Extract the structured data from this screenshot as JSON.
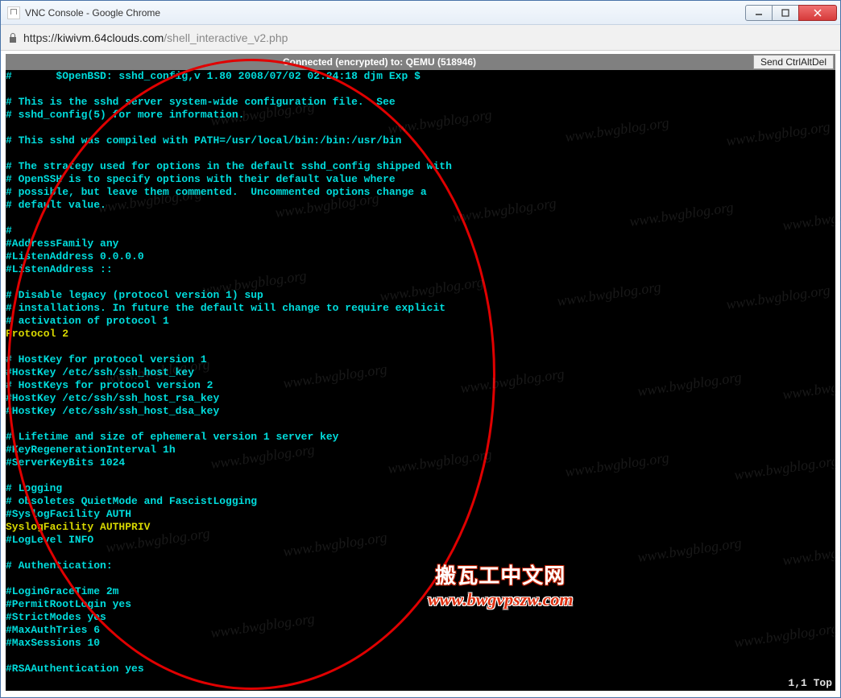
{
  "window": {
    "title": "VNC Console - Google Chrome"
  },
  "address": {
    "scheme": "https://",
    "host": "kiwivm.64clouds.com",
    "path": "/shell_interactive_v2.php"
  },
  "vnc": {
    "status": "Connected (encrypted) to: QEMU (518946)",
    "cad_button": "Send CtrlAltDel"
  },
  "terminal_lines": [
    {
      "t": "#       $OpenBSD: sshd_config,v 1.80 2008/07/02 02:24:18 djm Exp $",
      "c": "cyan"
    },
    {
      "t": "",
      "c": "cyan"
    },
    {
      "t": "# This is the sshd server system-wide configuration file.  See",
      "c": "cyan"
    },
    {
      "t": "# sshd_config(5) for more information.",
      "c": "cyan"
    },
    {
      "t": "",
      "c": "cyan"
    },
    {
      "t": "# This sshd was compiled with PATH=/usr/local/bin:/bin:/usr/bin",
      "c": "cyan"
    },
    {
      "t": "",
      "c": "cyan"
    },
    {
      "t": "# The strategy used for options in the default sshd_config shipped with",
      "c": "cyan"
    },
    {
      "t": "# OpenSSH is to specify options with their default value where",
      "c": "cyan"
    },
    {
      "t": "# possible, but leave them commented.  Uncommented options change a",
      "c": "cyan"
    },
    {
      "t": "# default value.",
      "c": "cyan"
    },
    {
      "t": "",
      "c": "cyan"
    },
    {
      "t": "#",
      "c": "cyan"
    },
    {
      "t": "#AddressFamily any",
      "c": "cyan"
    },
    {
      "t": "#ListenAddress 0.0.0.0",
      "c": "cyan"
    },
    {
      "t": "#ListenAddress ::",
      "c": "cyan"
    },
    {
      "t": "",
      "c": "cyan"
    },
    {
      "t": "# Disable legacy (protocol version 1) sup",
      "c": "cyan"
    },
    {
      "t": "# installations. In future the default will change to require explicit",
      "c": "cyan"
    },
    {
      "t": "# activation of protocol 1",
      "c": "cyan"
    },
    {
      "t": "Protocol 2",
      "c": "yellow"
    },
    {
      "t": "",
      "c": "cyan"
    },
    {
      "t": "# HostKey for protocol version 1",
      "c": "cyan"
    },
    {
      "t": "#HostKey /etc/ssh/ssh_host_key",
      "c": "cyan"
    },
    {
      "t": "# HostKeys for protocol version 2",
      "c": "cyan"
    },
    {
      "t": "#HostKey /etc/ssh/ssh_host_rsa_key",
      "c": "cyan"
    },
    {
      "t": "#HostKey /etc/ssh/ssh_host_dsa_key",
      "c": "cyan"
    },
    {
      "t": "",
      "c": "cyan"
    },
    {
      "t": "# Lifetime and size of ephemeral version 1 server key",
      "c": "cyan"
    },
    {
      "t": "#KeyRegenerationInterval 1h",
      "c": "cyan"
    },
    {
      "t": "#ServerKeyBits 1024",
      "c": "cyan"
    },
    {
      "t": "",
      "c": "cyan"
    },
    {
      "t": "# Logging",
      "c": "cyan"
    },
    {
      "t": "# obsoletes QuietMode and FascistLogging",
      "c": "cyan"
    },
    {
      "t": "#SyslogFacility AUTH",
      "c": "cyan"
    },
    {
      "t": "SyslogFacility AUTHPRIV",
      "c": "yellow"
    },
    {
      "t": "#LogLevel INFO",
      "c": "cyan"
    },
    {
      "t": "",
      "c": "cyan"
    },
    {
      "t": "# Authentication:",
      "c": "cyan"
    },
    {
      "t": "",
      "c": "cyan"
    },
    {
      "t": "#LoginGraceTime 2m",
      "c": "cyan"
    },
    {
      "t": "#PermitRootLogin yes",
      "c": "cyan"
    },
    {
      "t": "#StrictModes yes",
      "c": "cyan"
    },
    {
      "t": "#MaxAuthTries 6",
      "c": "cyan"
    },
    {
      "t": "#MaxSessions 10",
      "c": "cyan"
    },
    {
      "t": "",
      "c": "cyan"
    },
    {
      "t": "#RSAAuthentication yes",
      "c": "cyan"
    }
  ],
  "status_right": "1,1           Top",
  "overlay": {
    "line1": "搬瓦工中文网",
    "line2": "www.bwgvpszw.com",
    "faint": "www.bwgblog.org"
  }
}
